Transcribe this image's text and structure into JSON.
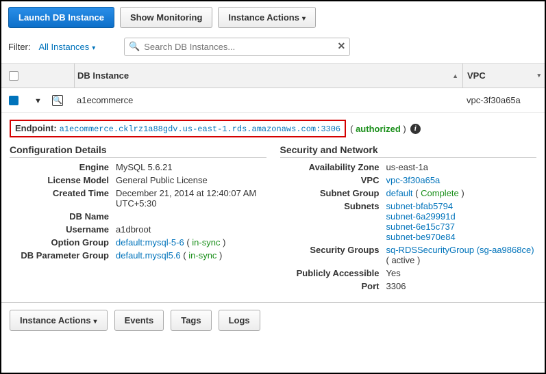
{
  "toolbar": {
    "launch": "Launch DB Instance",
    "monitoring": "Show Monitoring",
    "actions": "Instance Actions"
  },
  "filter": {
    "label": "Filter:",
    "link": "All Instances",
    "placeholder": "Search DB Instances..."
  },
  "columns": {
    "db": "DB Instance",
    "vpc": "VPC"
  },
  "row": {
    "name": "a1ecommerce",
    "vpc": "vpc-3f30a65a"
  },
  "endpoint": {
    "label": "Endpoint:",
    "value": "a1ecommerce.cklrz1a88gdv.us-east-1.rds.amazonaws.com:3306",
    "status": "authorized"
  },
  "config_title": "Configuration Details",
  "security_title": "Security and Network",
  "config": {
    "engine_k": "Engine",
    "engine_v": "MySQL 5.6.21",
    "license_k": "License Model",
    "license_v": "General Public License",
    "created_k": "Created Time",
    "created_v": "December 21, 2014 at 12:40:07 AM UTC+5:30",
    "dbname_k": "DB Name",
    "dbname_v": "",
    "username_k": "Username",
    "username_v": "a1dbroot",
    "optgrp_k": "Option Group",
    "optgrp_v": "default:mysql-5-6",
    "optgrp_status": "in-sync",
    "paramgrp_k": "DB Parameter Group",
    "paramgrp_v": "default.mysql5.6",
    "paramgrp_status": "in-sync"
  },
  "sec": {
    "az_k": "Availability Zone",
    "az_v": "us-east-1a",
    "vpc_k": "VPC",
    "vpc_v": "vpc-3f30a65a",
    "subgrp_k": "Subnet Group",
    "subgrp_v": "default",
    "subgrp_status": "Complete",
    "subnets_k": "Subnets",
    "subnet1": "subnet-bfab5794",
    "subnet2": "subnet-6a29991d",
    "subnet3": "subnet-6e15c737",
    "subnet4": "subnet-be970e84",
    "secgrp_k": "Security Groups",
    "secgrp_v": "sq-RDSSecurityGroup (sg-aa9868ce)",
    "secgrp_status": "active",
    "public_k": "Publicly Accessible",
    "public_v": "Yes",
    "port_k": "Port",
    "port_v": "3306"
  },
  "bottom": {
    "actions": "Instance Actions",
    "events": "Events",
    "tags": "Tags",
    "logs": "Logs"
  }
}
